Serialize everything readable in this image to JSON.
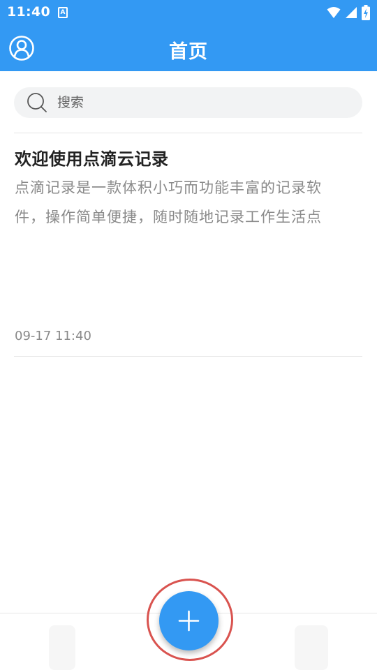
{
  "status_bar": {
    "time": "11:40",
    "notification_icon": "A",
    "icons": [
      "wifi-icon",
      "signal-icon",
      "battery-charging-icon"
    ]
  },
  "header": {
    "title": "首页",
    "left_icon": "user-profile-icon"
  },
  "search": {
    "placeholder": "搜索",
    "value": "",
    "icon": "search-icon"
  },
  "notes": [
    {
      "title": "欢迎使用点滴云记录",
      "preview_lines": [
        "点滴记录是一款体积小巧而功能丰富的记录软",
        "件，操作简单便捷，随时随地记录工作生活点"
      ],
      "time": "09-17 11:40"
    }
  ],
  "fab": {
    "icon": "plus-icon"
  },
  "colors": {
    "primary": "#3399f3",
    "highlight_ring": "#d9534f",
    "search_bg": "#f2f3f4",
    "text_main": "#222222",
    "text_muted": "#8a8a8a"
  }
}
